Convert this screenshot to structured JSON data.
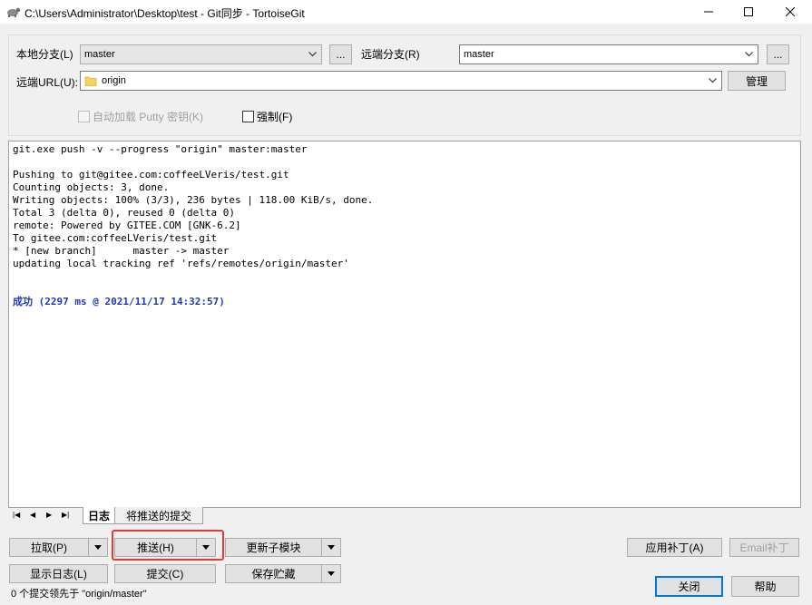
{
  "window": {
    "title": "C:\\Users\\Administrator\\Desktop\\test - Git同步 - TortoiseGit",
    "controls": [
      "minimize-icon",
      "maximize-icon",
      "close-icon"
    ]
  },
  "form": {
    "local_branch_label": "本地分支(L)",
    "local_branch_value": "master",
    "remote_branch_label": "远端分支(R)",
    "remote_branch_value": "master",
    "browse_label": "...",
    "remote_url_label": "远端URL(U):",
    "remote_url_value": "origin",
    "manage_label": "管理",
    "autoload_putty_label": "自动加载 Putty 密钥(K)",
    "autoload_putty_checked": false,
    "force_label": "强制(F)",
    "force_checked": false
  },
  "log": {
    "lines": [
      "git.exe push -v --progress \"origin\" master:master",
      "",
      "Pushing to git@gitee.com:coffeeLVeris/test.git",
      "Counting objects: 3, done.",
      "Writing objects: 100% (3/3), 236 bytes | 118.00 KiB/s, done.",
      "Total 3 (delta 0), reused 0 (delta 0)",
      "remote: Powered by GITEE.COM [GNK-6.2]",
      "To gitee.com:coffeeLVeris/test.git",
      "* [new branch]      master -> master",
      "updating local tracking ref 'refs/remotes/origin/master'",
      "",
      ""
    ],
    "success_line": "成功 (2297 ms @ 2021/11/17 14:32:57)"
  },
  "tabs": [
    {
      "label": "日志",
      "active": true
    },
    {
      "label": "将推送的提交",
      "active": false
    }
  ],
  "buttons": {
    "pull": "拉取(P)",
    "push": "推送(H)",
    "update_submodule": "更新子模块",
    "show_log": "显示日志(L)",
    "commit": "提交(C)",
    "stash": "保存贮藏",
    "apply_patch": "应用补丁(A)",
    "email_patch": "Email补丁",
    "close": "关闭",
    "help": "帮助"
  },
  "status_text": "0 个提交领先于 \"origin/master\"",
  "colors": {
    "success_text": "#1c39b8",
    "highlight": "#e53935",
    "default_button_border": "#0078d7"
  }
}
